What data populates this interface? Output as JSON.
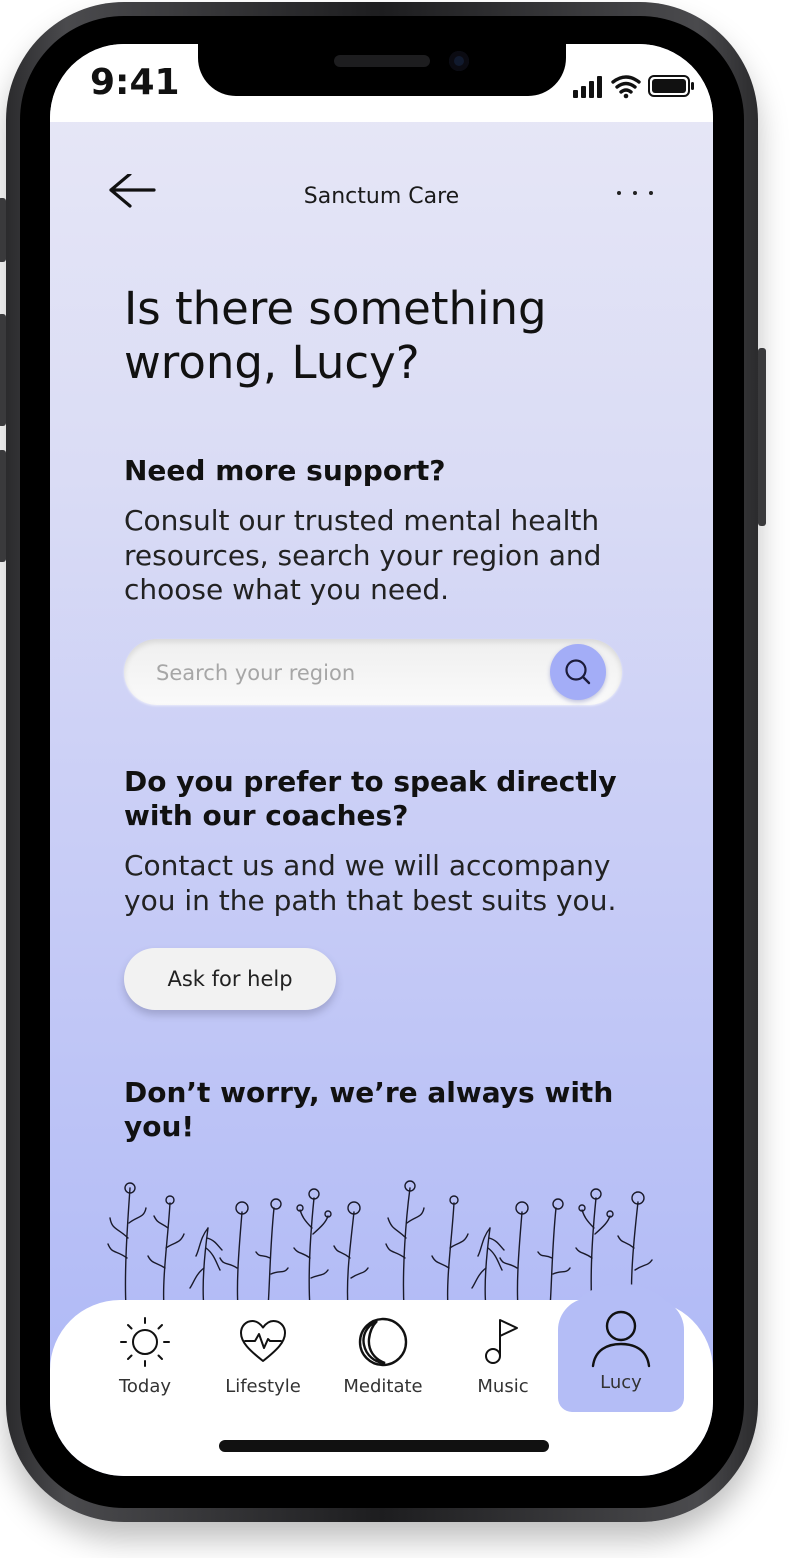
{
  "status_bar": {
    "time": "9:41"
  },
  "header": {
    "app_title": "Sanctum Care"
  },
  "headline": "Is there something wrong, Lucy?",
  "support": {
    "heading": "Need more support?",
    "body": "Consult our trusted mental health resources, search your region and choose what you need.",
    "search_placeholder": "Search your region"
  },
  "coaches": {
    "heading": "Do you prefer to speak directly with our coaches?",
    "body": "Contact us and we will accompany you in the path that best suits you.",
    "button_label": "Ask for help"
  },
  "reassurance": "Don’t worry, we’re always with you!",
  "tabs": [
    {
      "label": "Today",
      "icon": "sun-icon"
    },
    {
      "label": "Lifestyle",
      "icon": "heart-pulse-icon"
    },
    {
      "label": "Meditate",
      "icon": "moon-icon"
    },
    {
      "label": "Music",
      "icon": "music-note-icon"
    },
    {
      "label": "Lucy",
      "icon": "user-icon",
      "active": true
    }
  ],
  "colors": {
    "accent": "#a3adf7",
    "active_tab": "#b4bdf6",
    "background_top": "#e8e8f6",
    "background_bottom": "#aeb7f5"
  }
}
